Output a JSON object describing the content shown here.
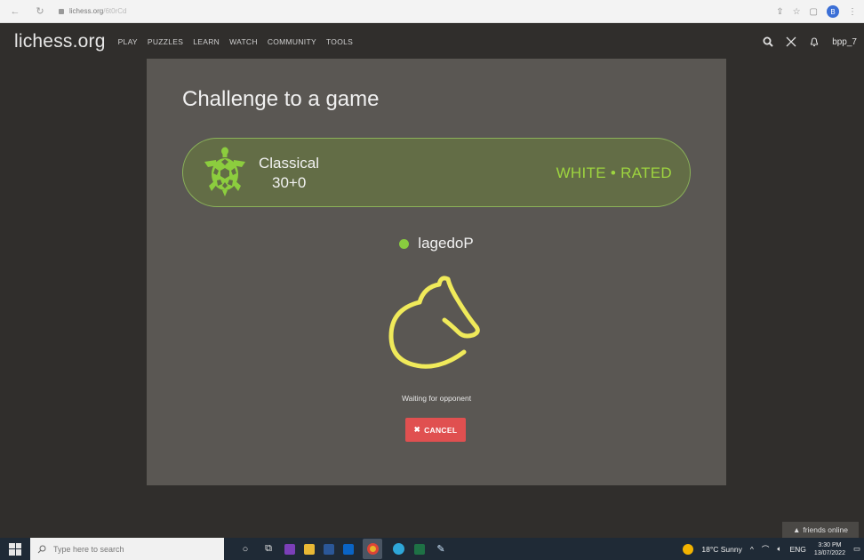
{
  "browser": {
    "url": "lichess.org",
    "url_tail": "/6t0rCd",
    "profile_initial": "B"
  },
  "header": {
    "logo": "lichess.org",
    "menu": [
      "PLAY",
      "PUZZLES",
      "LEARN",
      "WATCH",
      "COMMUNITY",
      "TOOLS"
    ],
    "username": "bpp_7"
  },
  "challenge": {
    "title": "Challenge to a game",
    "speed": "Classical",
    "time_control": "30+0",
    "color_rated": "WHITE • RATED",
    "opponent": "lagedoP",
    "status": "Waiting for opponent",
    "cancel_label": "CANCEL"
  },
  "friends": {
    "label": "friends online"
  },
  "taskbar": {
    "search_placeholder": "Type here to search",
    "weather": "18°C  Sunny",
    "lang": "ENG",
    "time": "3:30 PM",
    "date": "13/07/2022"
  },
  "colors": {
    "accent_green": "#9ed53f",
    "cancel_red": "#e05050",
    "knight_yellow": "#f0ea5a"
  }
}
